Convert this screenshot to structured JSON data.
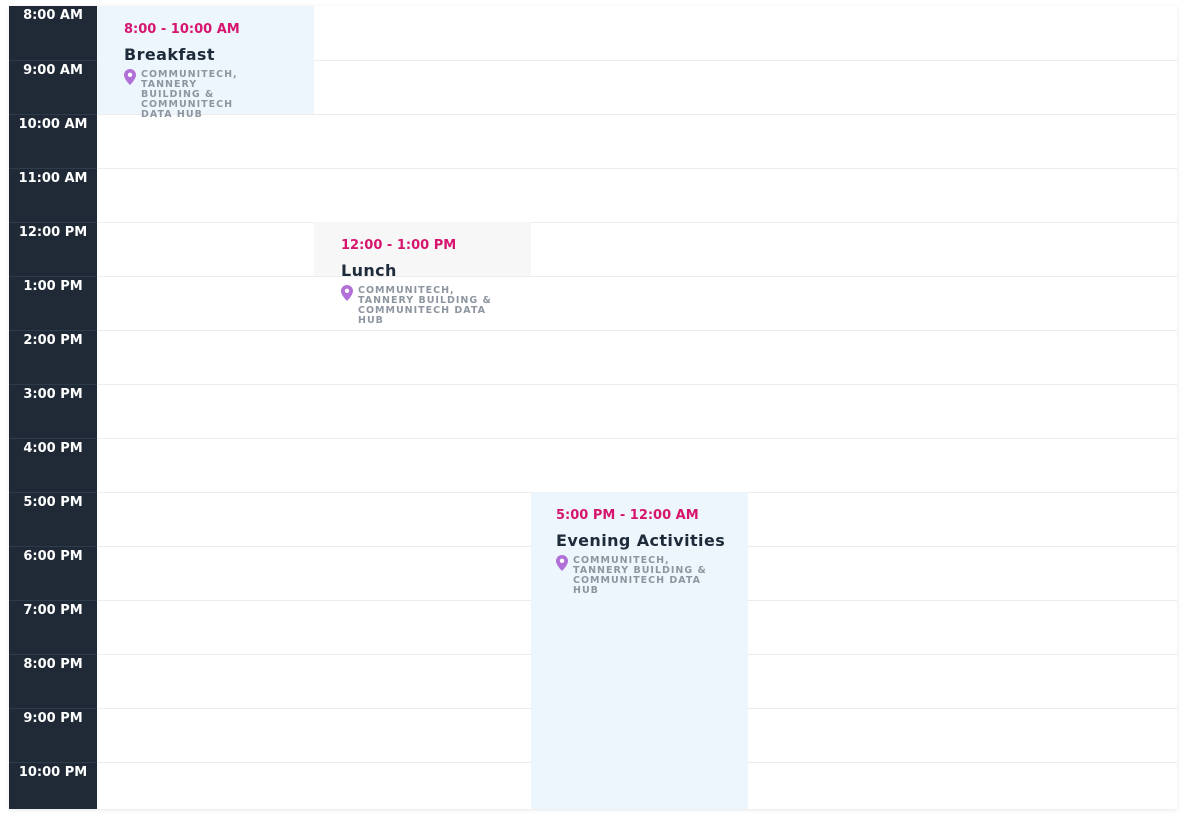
{
  "time_slots": [
    "8:00 AM",
    "9:00 AM",
    "10:00 AM",
    "11:00 AM",
    "12:00 PM",
    "1:00 PM",
    "2:00 PM",
    "3:00 PM",
    "4:00 PM",
    "5:00 PM",
    "6:00 PM",
    "7:00 PM",
    "8:00 PM",
    "9:00 PM",
    "10:00 PM"
  ],
  "events": [
    {
      "time": "8:00 - 10:00 AM",
      "title": "Breakfast",
      "location": "COMMUNITECH, TANNERY BUILDING & COMMUNITECH DATA HUB"
    },
    {
      "time": "12:00 - 1:00 PM",
      "title": "Lunch",
      "location": "COMMUNITECH, TANNERY BUILDING & COMMUNITECH DATA HUB"
    },
    {
      "time": "5:00 PM - 12:00 AM",
      "title": "Evening Activities",
      "location": "COMMUNITECH, TANNERY BUILDING & COMMUNITECH DATA HUB"
    }
  ],
  "colors": {
    "sidebar_bg": "#1f2a36",
    "event_time": "#d6156f",
    "event_title": "#1d2b3a",
    "location_text": "#8d96a0",
    "pin_icon": "#b16fd8",
    "event_blue_bg": "#eef6fd",
    "event_gray_bg": "#f7f7f7"
  },
  "icons": {
    "location": "map-pin-icon"
  }
}
